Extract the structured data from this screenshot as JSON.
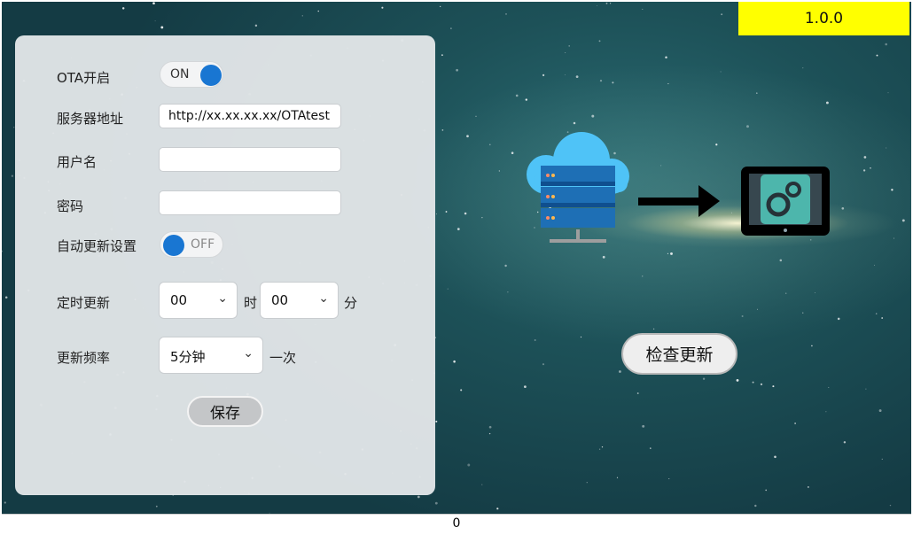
{
  "version": "1.0.0",
  "form": {
    "ota_enable_label": "OTA开启",
    "ota_toggle": {
      "state": "on",
      "text": "ON"
    },
    "server_label": "服务器地址",
    "server_value": "http://xx.xx.xx.xx/OTAtest",
    "username_label": "用户名",
    "username_value": "",
    "password_label": "密码",
    "password_value": "",
    "auto_update_label": "自动更新设置",
    "auto_toggle": {
      "state": "off",
      "text": "OFF"
    },
    "scheduled_label": "定时更新",
    "hour_value": "00",
    "hour_unit": "时",
    "minute_value": "00",
    "minute_unit": "分",
    "frequency_label": "更新频率",
    "frequency_value": "5分钟",
    "frequency_suffix": "一次",
    "save_label": "保存"
  },
  "check_update_label": "检查更新",
  "status_value": "0",
  "icons": [
    "cloud-server-icon",
    "arrow-right-icon",
    "tablet-settings-icon",
    "chevron-down-icon"
  ],
  "colors": {
    "version_bg": "#ffff00",
    "toggle_knob": "#1976d2",
    "panel_bg": "#e2e6e8"
  }
}
